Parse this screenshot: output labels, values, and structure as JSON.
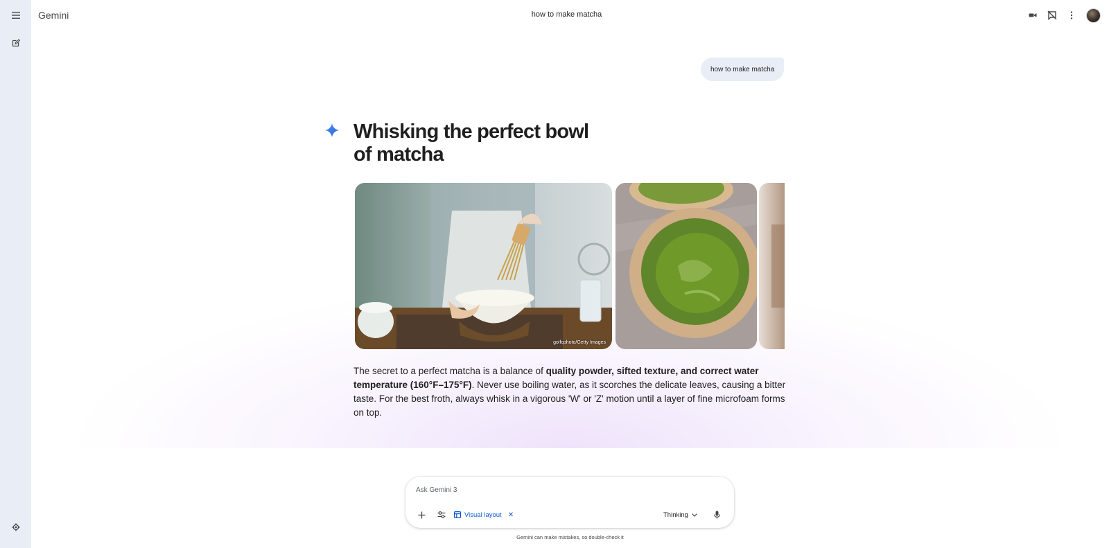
{
  "app": {
    "brand": "Gemini",
    "chat_title": "how to make matcha"
  },
  "sidebar": {
    "icons": [
      "menu-icon",
      "new-chat-icon",
      "settings-icon"
    ]
  },
  "conversation": {
    "user_message": "how to make matcha",
    "response_title": "Whisking the perfect bowl of matcha",
    "image_credit": "golfcphoto/Getty Images",
    "answer": {
      "intro": "The secret to a perfect matcha is a balance of ",
      "bold": "quality powder, sifted texture, and correct water temperature (160°F–175°F)",
      "rest": ". Never use boiling water, as it scorches the delicate leaves, causing a bitter taste. For the best froth, always whisk in a vigorous 'W' or 'Z' motion until a layer of fine microfoam forms on top."
    }
  },
  "composer": {
    "placeholder": "Ask Gemini 3",
    "value": "",
    "chip_label": "Visual layout",
    "mode_label": "Thinking"
  },
  "footer": {
    "disclaimer": "Gemini can make mistakes, so double-check it"
  },
  "colors": {
    "sidebar_bg": "#e9eef6",
    "accent": "#0b57d0",
    "sparkle": "#4285f4",
    "matcha_green": "#6f9a2a"
  }
}
